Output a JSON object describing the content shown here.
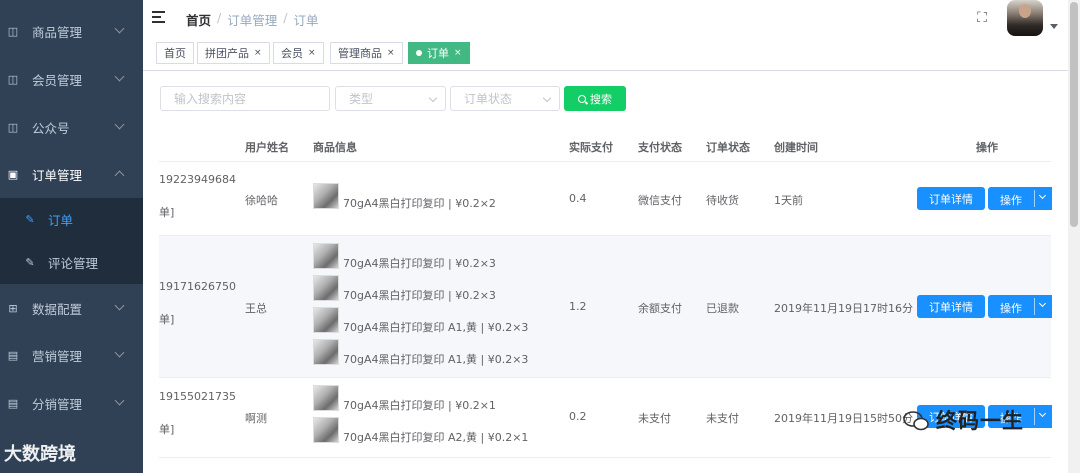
{
  "sidebar": {
    "items": [
      {
        "label": "商品管理",
        "icon": "box-icon"
      },
      {
        "label": "会员管理",
        "icon": "box-icon"
      },
      {
        "label": "公众号",
        "icon": "box-icon"
      },
      {
        "label": "订单管理",
        "icon": "lock-icon"
      },
      {
        "label": "数据配置",
        "icon": "grid-icon"
      },
      {
        "label": "营销管理",
        "icon": "doc-icon"
      },
      {
        "label": "分销管理",
        "icon": "doc-icon"
      }
    ],
    "sub_items": [
      {
        "label": "订单",
        "icon": "doc-edit-icon"
      },
      {
        "label": "评论管理",
        "icon": "doc-edit-icon"
      }
    ]
  },
  "breadcrumb": {
    "home": "首页",
    "sep": "/",
    "level1": "订单管理",
    "level2": "订单"
  },
  "tags": [
    {
      "label": "首页"
    },
    {
      "label": "拼团产品"
    },
    {
      "label": "会员"
    },
    {
      "label": "管理商品"
    },
    {
      "label": "订单"
    }
  ],
  "tag_close": "×",
  "filter": {
    "search_placeholder": "输入搜索内容",
    "type_placeholder": "类型",
    "status_placeholder": "订单状态",
    "search_button": "搜索"
  },
  "table": {
    "headers": [
      "用户姓名",
      "商品信息",
      "实际支付",
      "支付状态",
      "订单状态",
      "创建时间",
      "操作"
    ],
    "detail_button": "订单详情",
    "op_button": "操作",
    "rows": [
      {
        "order_no": "19223949684",
        "order_suffix": "单]",
        "user": "徐哈哈",
        "goods": [
          "70gA4黑白打印复印 | ¥0.2×2"
        ],
        "paid": "0.4",
        "pay_status": "微信支付",
        "order_status": "待收货",
        "created": "1天前"
      },
      {
        "order_no": "19171626750",
        "order_suffix": "单]",
        "user": "王总",
        "goods": [
          "70gA4黑白打印复印 | ¥0.2×3",
          "70gA4黑白打印复印 | ¥0.2×3",
          "70gA4黑白打印复印 A1,黄 | ¥0.2×3",
          "70gA4黑白打印复印 A1,黄 | ¥0.2×3"
        ],
        "paid": "1.2",
        "pay_status": "余额支付",
        "order_status": "已退款",
        "created": "2019年11月19日17时16分"
      },
      {
        "order_no": "19155021735",
        "order_suffix": "单]",
        "user": "啊测",
        "goods": [
          "70gA4黑白打印复印 | ¥0.2×1",
          "70gA4黑白打印复印 A2,黄 | ¥0.2×1"
        ],
        "paid": "0.2",
        "pay_status": "未支付",
        "order_status": "未支付",
        "created": "2019年11月19日15时50分"
      }
    ]
  },
  "watermarks": {
    "left": "大数跨境",
    "right": "终码一生"
  },
  "colors": {
    "sidebar": "#304156",
    "active_tag": "#42b983",
    "search_button": "#13ce66",
    "primary": "#1890ff",
    "submenu_active": "#409eff"
  }
}
